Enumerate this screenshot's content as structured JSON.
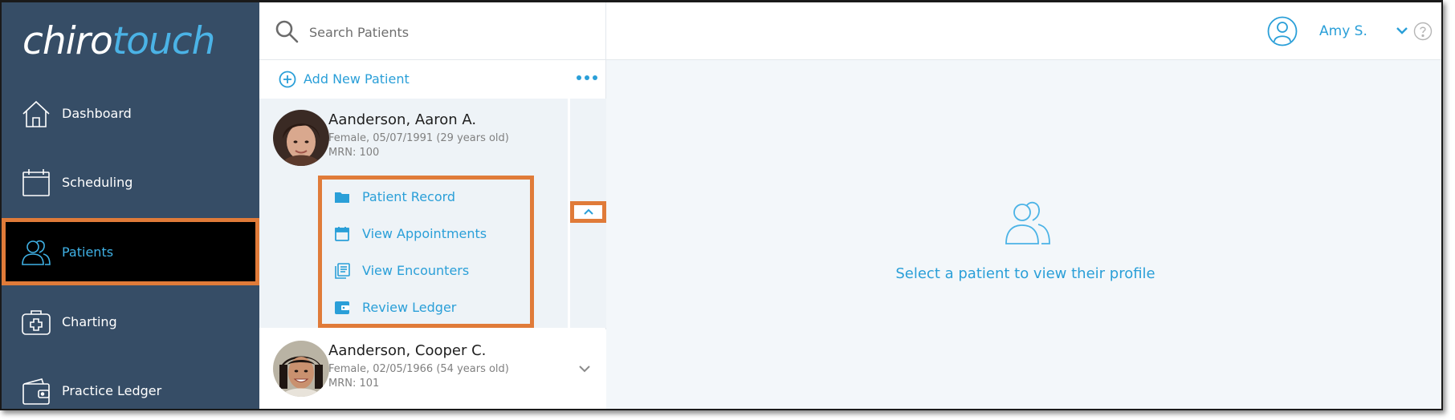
{
  "app": {
    "logo_part1": "chiro",
    "logo_part2": "touch"
  },
  "colors": {
    "sidebar_bg": "#364d66",
    "accent": "#2a9fd8",
    "highlight_border": "#e07b39"
  },
  "sidebar": {
    "items": [
      {
        "label": "Dashboard",
        "icon": "house-icon",
        "active": false
      },
      {
        "label": "Scheduling",
        "icon": "calendar-icon",
        "active": false
      },
      {
        "label": "Patients",
        "icon": "users-icon",
        "active": true
      },
      {
        "label": "Charting",
        "icon": "medical-kit-icon",
        "active": false
      },
      {
        "label": "Practice Ledger",
        "icon": "wallet-icon",
        "active": false
      }
    ]
  },
  "search": {
    "placeholder": "Search Patients",
    "value": ""
  },
  "patient_list": {
    "add_label": "Add New Patient",
    "patients": [
      {
        "name": "Aanderson, Aaron A.",
        "details": "Female, 05/07/1991 (29 years old)",
        "mrn": "MRN: 100",
        "expanded": true
      },
      {
        "name": "Aanderson, Cooper C.",
        "details": "Female, 02/05/1966 (54 years old)",
        "mrn": "MRN: 101",
        "expanded": false
      }
    ],
    "actions": [
      {
        "label": "Patient Record",
        "icon": "folder-icon"
      },
      {
        "label": "View Appointments",
        "icon": "calendar-icon"
      },
      {
        "label": "View Encounters",
        "icon": "documents-icon"
      },
      {
        "label": "Review Ledger",
        "icon": "ledger-icon"
      }
    ]
  },
  "header": {
    "user_name": "Amy S."
  },
  "main": {
    "empty_message": "Select a patient to view their profile"
  }
}
